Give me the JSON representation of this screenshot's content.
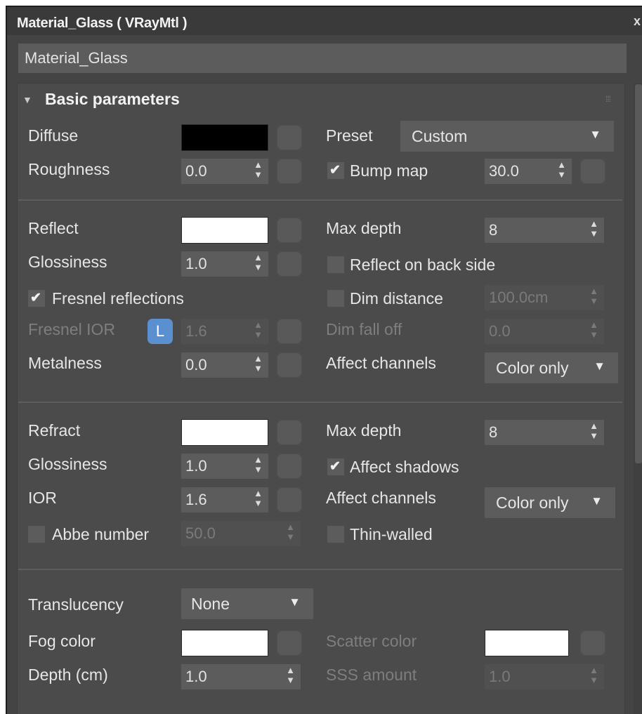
{
  "window": {
    "title": "Material_Glass  ( VRayMtl )",
    "close_label": "x",
    "name_value": "Material_Glass"
  },
  "rollout": {
    "title": "Basic parameters"
  },
  "diffuse": {
    "diffuse_label": "Diffuse",
    "preset_label": "Preset",
    "preset_value": "Custom",
    "roughness_label": "Roughness",
    "roughness_value": "0.0",
    "bump_label": "Bump map",
    "bump_value": "30.0"
  },
  "reflection": {
    "reflect_label": "Reflect",
    "max_depth_label": "Max depth",
    "max_depth_value": "8",
    "glossiness_label": "Glossiness",
    "glossiness_value": "1.0",
    "back_side_label": "Reflect on back side",
    "fresnel_label": "Fresnel reflections",
    "dim_distance_label": "Dim distance",
    "dim_distance_value": "100.0cm",
    "fresnel_ior_label": "Fresnel IOR",
    "lock_label": "L",
    "fresnel_ior_value": "1.6",
    "dim_falloff_label": "Dim fall off",
    "dim_falloff_value": "0.0",
    "metalness_label": "Metalness",
    "metalness_value": "0.0",
    "affect_channels_label": "Affect channels",
    "affect_channels_value": "Color only"
  },
  "refraction": {
    "refract_label": "Refract",
    "max_depth_label": "Max depth",
    "max_depth_value": "8",
    "glossiness_label": "Glossiness",
    "glossiness_value": "1.0",
    "affect_shadows_label": "Affect shadows",
    "ior_label": "IOR",
    "ior_value": "1.6",
    "affect_channels_label": "Affect channels",
    "affect_channels_value": "Color only",
    "abbe_label": "Abbe number",
    "abbe_value": "50.0",
    "thin_walled_label": "Thin-walled"
  },
  "translucency": {
    "translucency_label": "Translucency",
    "translucency_value": "None",
    "fog_color_label": "Fog color",
    "scatter_color_label": "Scatter color",
    "depth_label": "Depth (cm)",
    "depth_value": "1.0",
    "sss_label": "SSS amount",
    "sss_value": "1.0"
  },
  "glyphs": {
    "check": "✔",
    "caret": "▼",
    "collapse": "▼",
    "spin_up": "▲",
    "spin_down": "▼",
    "grip": "⁞⁞⁞"
  },
  "colors": {
    "panel": "#444444",
    "field": "#5c5c5c",
    "accent_lock": "#5a8fd0"
  }
}
